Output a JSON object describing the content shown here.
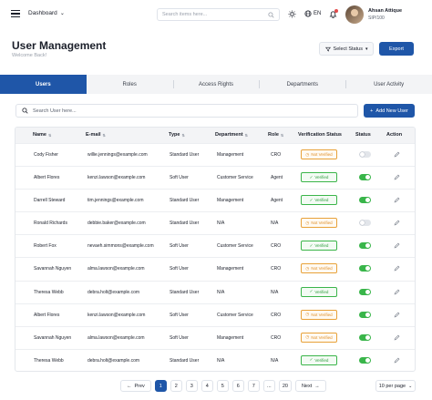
{
  "header": {
    "nav_label": "Dashboard",
    "search_placeholder": "Search items here...",
    "language": "EN",
    "user_name": "Ahsan Attique",
    "user_id": "SIP/100"
  },
  "page": {
    "title": "User Management",
    "subtitle": "Welcome Back!",
    "select_status_label": "Select Status",
    "export_label": "Export"
  },
  "tabs": [
    {
      "label": "Users",
      "active": true
    },
    {
      "label": "Roles",
      "active": false
    },
    {
      "label": "Access Rights",
      "active": false
    },
    {
      "label": "Departments",
      "active": false
    },
    {
      "label": "User Activity",
      "active": false
    }
  ],
  "toolbar": {
    "search_placeholder": "Search User here...",
    "add_user_label": "Add New User"
  },
  "table": {
    "columns": [
      "Name",
      "E-mail",
      "Type",
      "Department",
      "Role",
      "Verification Status",
      "Status",
      "Action"
    ],
    "rows": [
      {
        "name": "Cody Fisher",
        "email": "willie.jennings@example.com",
        "type": "Standard User",
        "department": "Management",
        "role": "CRO",
        "verification": "Not Verified",
        "verified": false,
        "status_on": false
      },
      {
        "name": "Albert Flores",
        "email": "kenzi.lawson@example.com",
        "type": "Soft User",
        "department": "Customer Service",
        "role": "Agent",
        "verification": "Verified",
        "verified": true,
        "status_on": true
      },
      {
        "name": "Darrell Steward",
        "email": "tim.jennings@example.com",
        "type": "Standard User",
        "department": "Management",
        "role": "Agent",
        "verification": "Verified",
        "verified": true,
        "status_on": true
      },
      {
        "name": "Ronald Richards",
        "email": "debbie.baker@example.com",
        "type": "Standard User",
        "department": "N/A",
        "role": "N/A",
        "verification": "Not Verified",
        "verified": false,
        "status_on": false
      },
      {
        "name": "Robert Fox",
        "email": "nevaeh.simmons@example.com",
        "type": "Soft User",
        "department": "Customer Service",
        "role": "CRO",
        "verification": "Verified",
        "verified": true,
        "status_on": true
      },
      {
        "name": "Savannah Nguyen",
        "email": "alma.lawson@example.com",
        "type": "Soft User",
        "department": "Management",
        "role": "CRO",
        "verification": "Not Verified",
        "verified": false,
        "status_on": true
      },
      {
        "name": "Theresa Webb",
        "email": "debra.holt@example.com",
        "type": "Standard User",
        "department": "N/A",
        "role": "N/A",
        "verification": "Verified",
        "verified": true,
        "status_on": true
      },
      {
        "name": "Albert Flores",
        "email": "kenzi.lawson@example.com",
        "type": "Soft User",
        "department": "Customer Service",
        "role": "CRO",
        "verification": "Not Verified",
        "verified": false,
        "status_on": true
      },
      {
        "name": "Savannah Nguyen",
        "email": "alma.lawson@example.com",
        "type": "Soft User",
        "department": "Management",
        "role": "CRO",
        "verification": "Not Verified",
        "verified": false,
        "status_on": true
      },
      {
        "name": "Theresa Webb",
        "email": "debra.holt@example.com",
        "type": "Standard User",
        "department": "N/A",
        "role": "N/A",
        "verification": "Verified",
        "verified": true,
        "status_on": true
      }
    ]
  },
  "pagination": {
    "prev_label": "Prev",
    "next_label": "Next",
    "pages": [
      "1",
      "2",
      "3",
      "4",
      "5",
      "6",
      "7",
      "...",
      "20"
    ],
    "current": "1",
    "per_page_label": "10 per page"
  },
  "colors": {
    "primary": "#1f56a8",
    "verified": "#3bb54a",
    "not_verified": "#e8a23a",
    "notification": "#e24b4b"
  },
  "icons": {
    "menu": "hamburger-icon",
    "search": "search-icon",
    "theme": "sun-icon",
    "language": "globe-icon",
    "notifications": "bell-icon",
    "edit": "pencil-icon"
  }
}
